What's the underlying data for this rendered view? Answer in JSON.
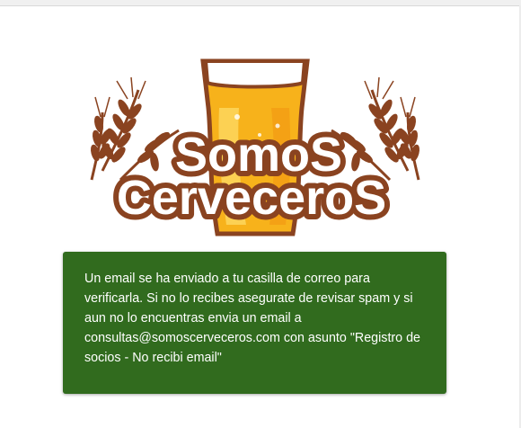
{
  "logo": {
    "line1": "SomoS",
    "line2": "CerveceroS",
    "colors": {
      "brown": "#8a4320",
      "beer": "#f7b21b",
      "beer_light": "#fcd45a",
      "foam": "#ffffff",
      "wheat": "#8a4320"
    }
  },
  "notice": {
    "message": "Un email se ha enviado a tu casilla de correo para verificarla. Si no lo recibes asegurate de revisar spam y si aun no lo encuentras envia un email a consultas@somoscerveceros.com con asunto \"Registro de socios - No recibi email\"",
    "background": "#316b1e",
    "text_color": "#ffffff"
  }
}
